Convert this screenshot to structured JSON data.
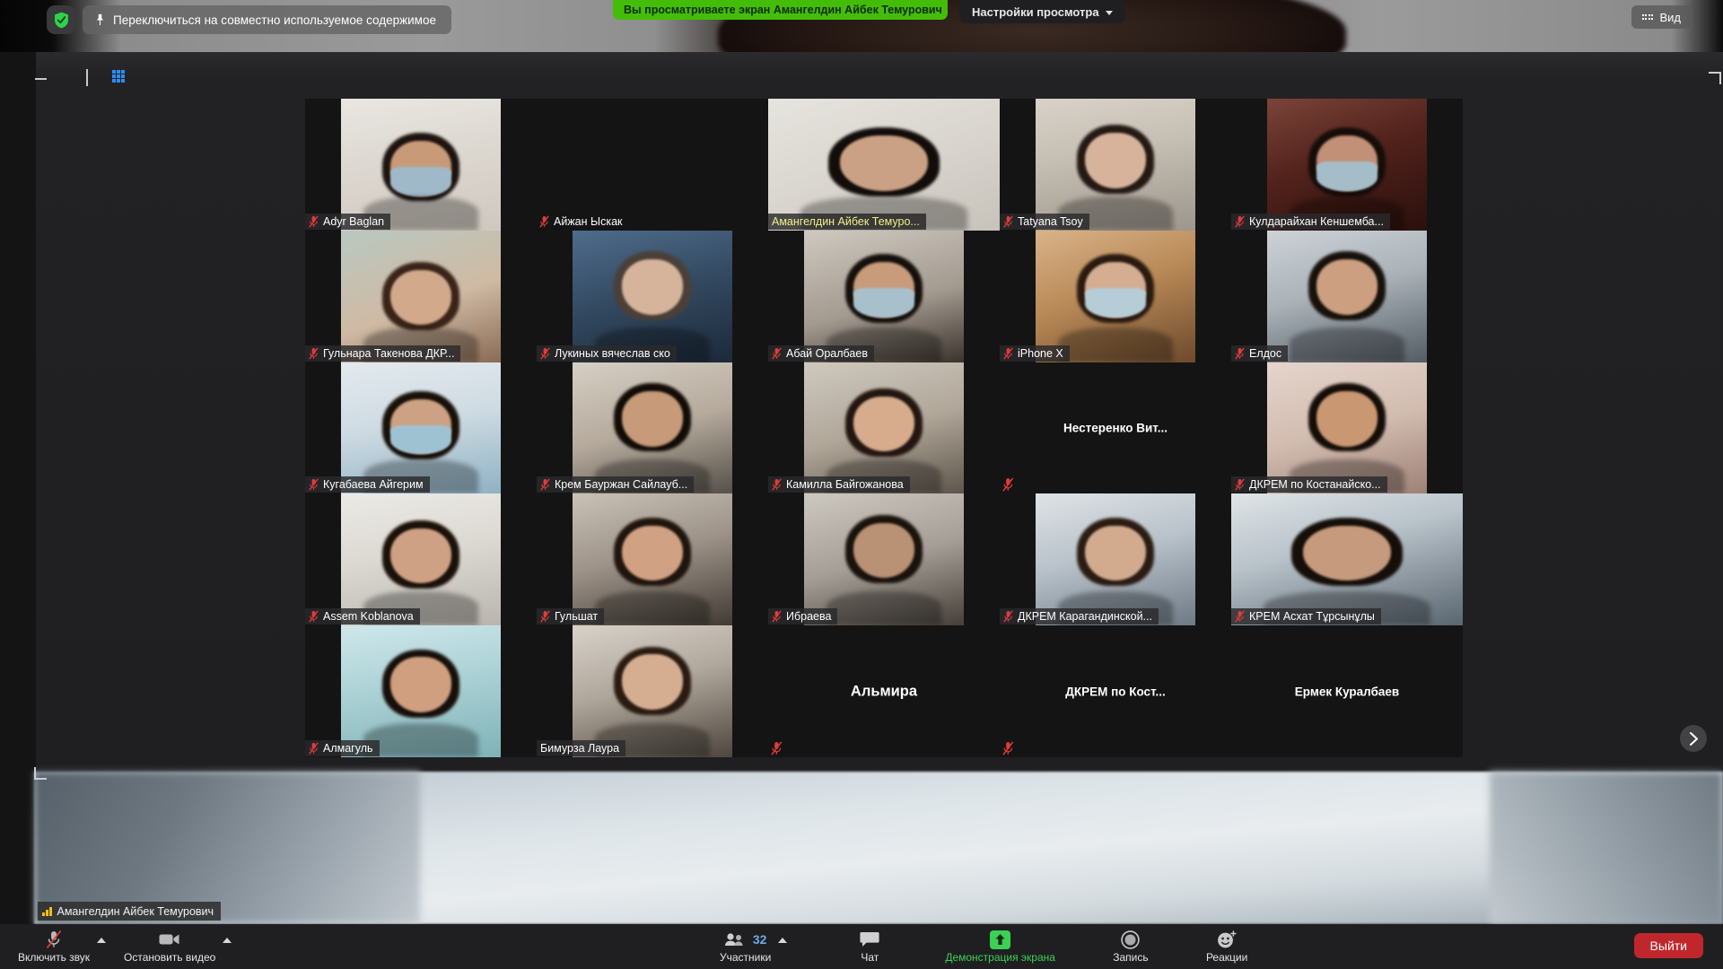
{
  "app": {
    "title": "Zoom Meeting"
  },
  "topbar": {
    "shield_icon": "security-shield-icon",
    "switch_shared_label": "Переключиться на совместно используемое содержимое",
    "pin_icon": "pin-icon",
    "viewing_banner": "Вы просматриваете экран Амангелдин Айбек Темурович",
    "view_settings_label": "Настройки просмотра",
    "chevron_icon": "chevron-down-icon",
    "vid_label": "Вид",
    "vid_icon": "grid-view-icon"
  },
  "window_controls": {
    "minimize_icon": "minimize-icon",
    "maximize_icon": "maximize-icon",
    "split_icon": "split-view-icon",
    "gallery_icon": "gallery-view-icon"
  },
  "gallery": {
    "next_page_icon": "chevron-right-icon",
    "mute_icon": "microphone-muted-icon",
    "tiles": [
      {
        "name": "Adyr Baglan",
        "video": true,
        "muted": true,
        "active": false,
        "label_style": "overlay",
        "vw": "w-mid",
        "skin": "a"
      },
      {
        "name": "Айжан Ыскак",
        "video": false,
        "muted": true,
        "active": false,
        "label_style": "bare",
        "vw": "w-nar",
        "skin": "b"
      },
      {
        "name": "Амангелдин Айбек Темуро...",
        "video": true,
        "muted": false,
        "active": true,
        "label_style": "overlay",
        "vw": "w-wid",
        "skin": "c"
      },
      {
        "name": "Tatyana Tsoy",
        "video": true,
        "muted": true,
        "active": false,
        "label_style": "overlay",
        "vw": "w-mid",
        "skin": "d"
      },
      {
        "name": "Кулдарайхан Кеншемба...",
        "video": true,
        "muted": true,
        "active": false,
        "label_style": "overlay",
        "vw": "w-mid",
        "skin": "e"
      },
      {
        "name": "Гульнара Такенова ДКР...",
        "video": true,
        "muted": true,
        "active": false,
        "label_style": "overlay",
        "vw": "w-mid",
        "skin": "f"
      },
      {
        "name": "Лукиных вячеслав ско",
        "video": true,
        "muted": true,
        "active": false,
        "label_style": "overlay",
        "vw": "w-mid",
        "skin": "g"
      },
      {
        "name": "Абай Оралбаев",
        "video": true,
        "muted": true,
        "active": false,
        "label_style": "overlay",
        "vw": "w-mid",
        "skin": "h"
      },
      {
        "name": "iPhone X",
        "video": true,
        "muted": true,
        "active": false,
        "label_style": "overlay",
        "vw": "w-mid",
        "skin": "i"
      },
      {
        "name": "Елдос",
        "video": true,
        "muted": true,
        "active": false,
        "label_style": "overlay",
        "vw": "w-mid",
        "skin": "j"
      },
      {
        "name": "Кугабаева Айгерим",
        "video": true,
        "muted": true,
        "active": false,
        "label_style": "overlay",
        "vw": "w-mid",
        "skin": "k"
      },
      {
        "name": "Крем Бауржан Сайлауб...",
        "video": true,
        "muted": true,
        "active": false,
        "label_style": "overlay",
        "vw": "w-mid",
        "skin": "l"
      },
      {
        "name": "Камилла Байгожанова",
        "video": true,
        "muted": true,
        "active": false,
        "label_style": "overlay",
        "vw": "w-mid",
        "skin": "m"
      },
      {
        "name": "Нестеренко Вит...",
        "video": false,
        "muted": true,
        "active": false,
        "label_style": "center",
        "vw": "w-nar",
        "skin": "n"
      },
      {
        "name": "ДКРЕМ по Костанайско...",
        "video": true,
        "muted": true,
        "active": false,
        "label_style": "overlay",
        "vw": "w-mid",
        "skin": "o"
      },
      {
        "name": "Assem Koblanova",
        "video": true,
        "muted": true,
        "active": false,
        "label_style": "overlay",
        "vw": "w-mid",
        "skin": "p"
      },
      {
        "name": "Гульшат",
        "video": true,
        "muted": true,
        "active": false,
        "label_style": "overlay",
        "vw": "w-mid",
        "skin": "q"
      },
      {
        "name": "Ибраева",
        "video": true,
        "muted": true,
        "active": false,
        "label_style": "overlay",
        "vw": "w-mid",
        "skin": "r"
      },
      {
        "name": "ДКРЕМ Карагандинской...",
        "video": true,
        "muted": true,
        "active": false,
        "label_style": "overlay",
        "vw": "w-mid",
        "skin": "s"
      },
      {
        "name": "КРЕМ Асхат Тұрсынұлы",
        "video": true,
        "muted": true,
        "active": false,
        "label_style": "overlay",
        "vw": "w-wid",
        "skin": "t"
      },
      {
        "name": "Алмагуль",
        "video": true,
        "muted": true,
        "active": false,
        "label_style": "overlay",
        "vw": "w-mid",
        "skin": "u"
      },
      {
        "name": "Бимурза Лаура",
        "video": true,
        "muted": false,
        "active": false,
        "label_style": "overlay",
        "vw": "w-mid",
        "skin": "v"
      },
      {
        "name": "Альмира",
        "video": false,
        "muted": true,
        "active": false,
        "label_style": "center",
        "vw": "w-nar",
        "skin": "w"
      },
      {
        "name": "ДКРЕМ по Кост...",
        "video": false,
        "muted": true,
        "active": false,
        "label_style": "center",
        "vw": "w-nar",
        "skin": "x"
      },
      {
        "name": "Ермек Куралбаев",
        "video": false,
        "muted": false,
        "active": false,
        "label_style": "center",
        "vw": "w-nar",
        "skin": "y"
      }
    ]
  },
  "self_label": {
    "name": "Амангелдин Айбек Темурович",
    "signal_icon": "network-signal-icon"
  },
  "toolbar": {
    "mute": {
      "label": "Включить звук",
      "icon": "microphone-muted-icon"
    },
    "video": {
      "label": "Остановить видео",
      "icon": "video-camera-icon"
    },
    "participants": {
      "label": "Участники",
      "count": "32",
      "icon": "participants-icon"
    },
    "chat": {
      "label": "Чат",
      "icon": "chat-bubble-icon"
    },
    "share": {
      "label": "Демонстрация экрана",
      "icon": "share-screen-icon"
    },
    "record": {
      "label": "Запись",
      "icon": "record-circle-icon"
    },
    "reactions": {
      "label": "Реакции",
      "icon": "smiley-reaction-icon"
    },
    "leave": {
      "label": "Выйти"
    }
  },
  "colors": {
    "banner_green": "#44bd09",
    "share_green": "#3bd154",
    "leave_red": "#c0272d",
    "accent_blue": "#2d8cff",
    "active_border": "#d8e13c",
    "mute_red": "#e03b3b"
  }
}
